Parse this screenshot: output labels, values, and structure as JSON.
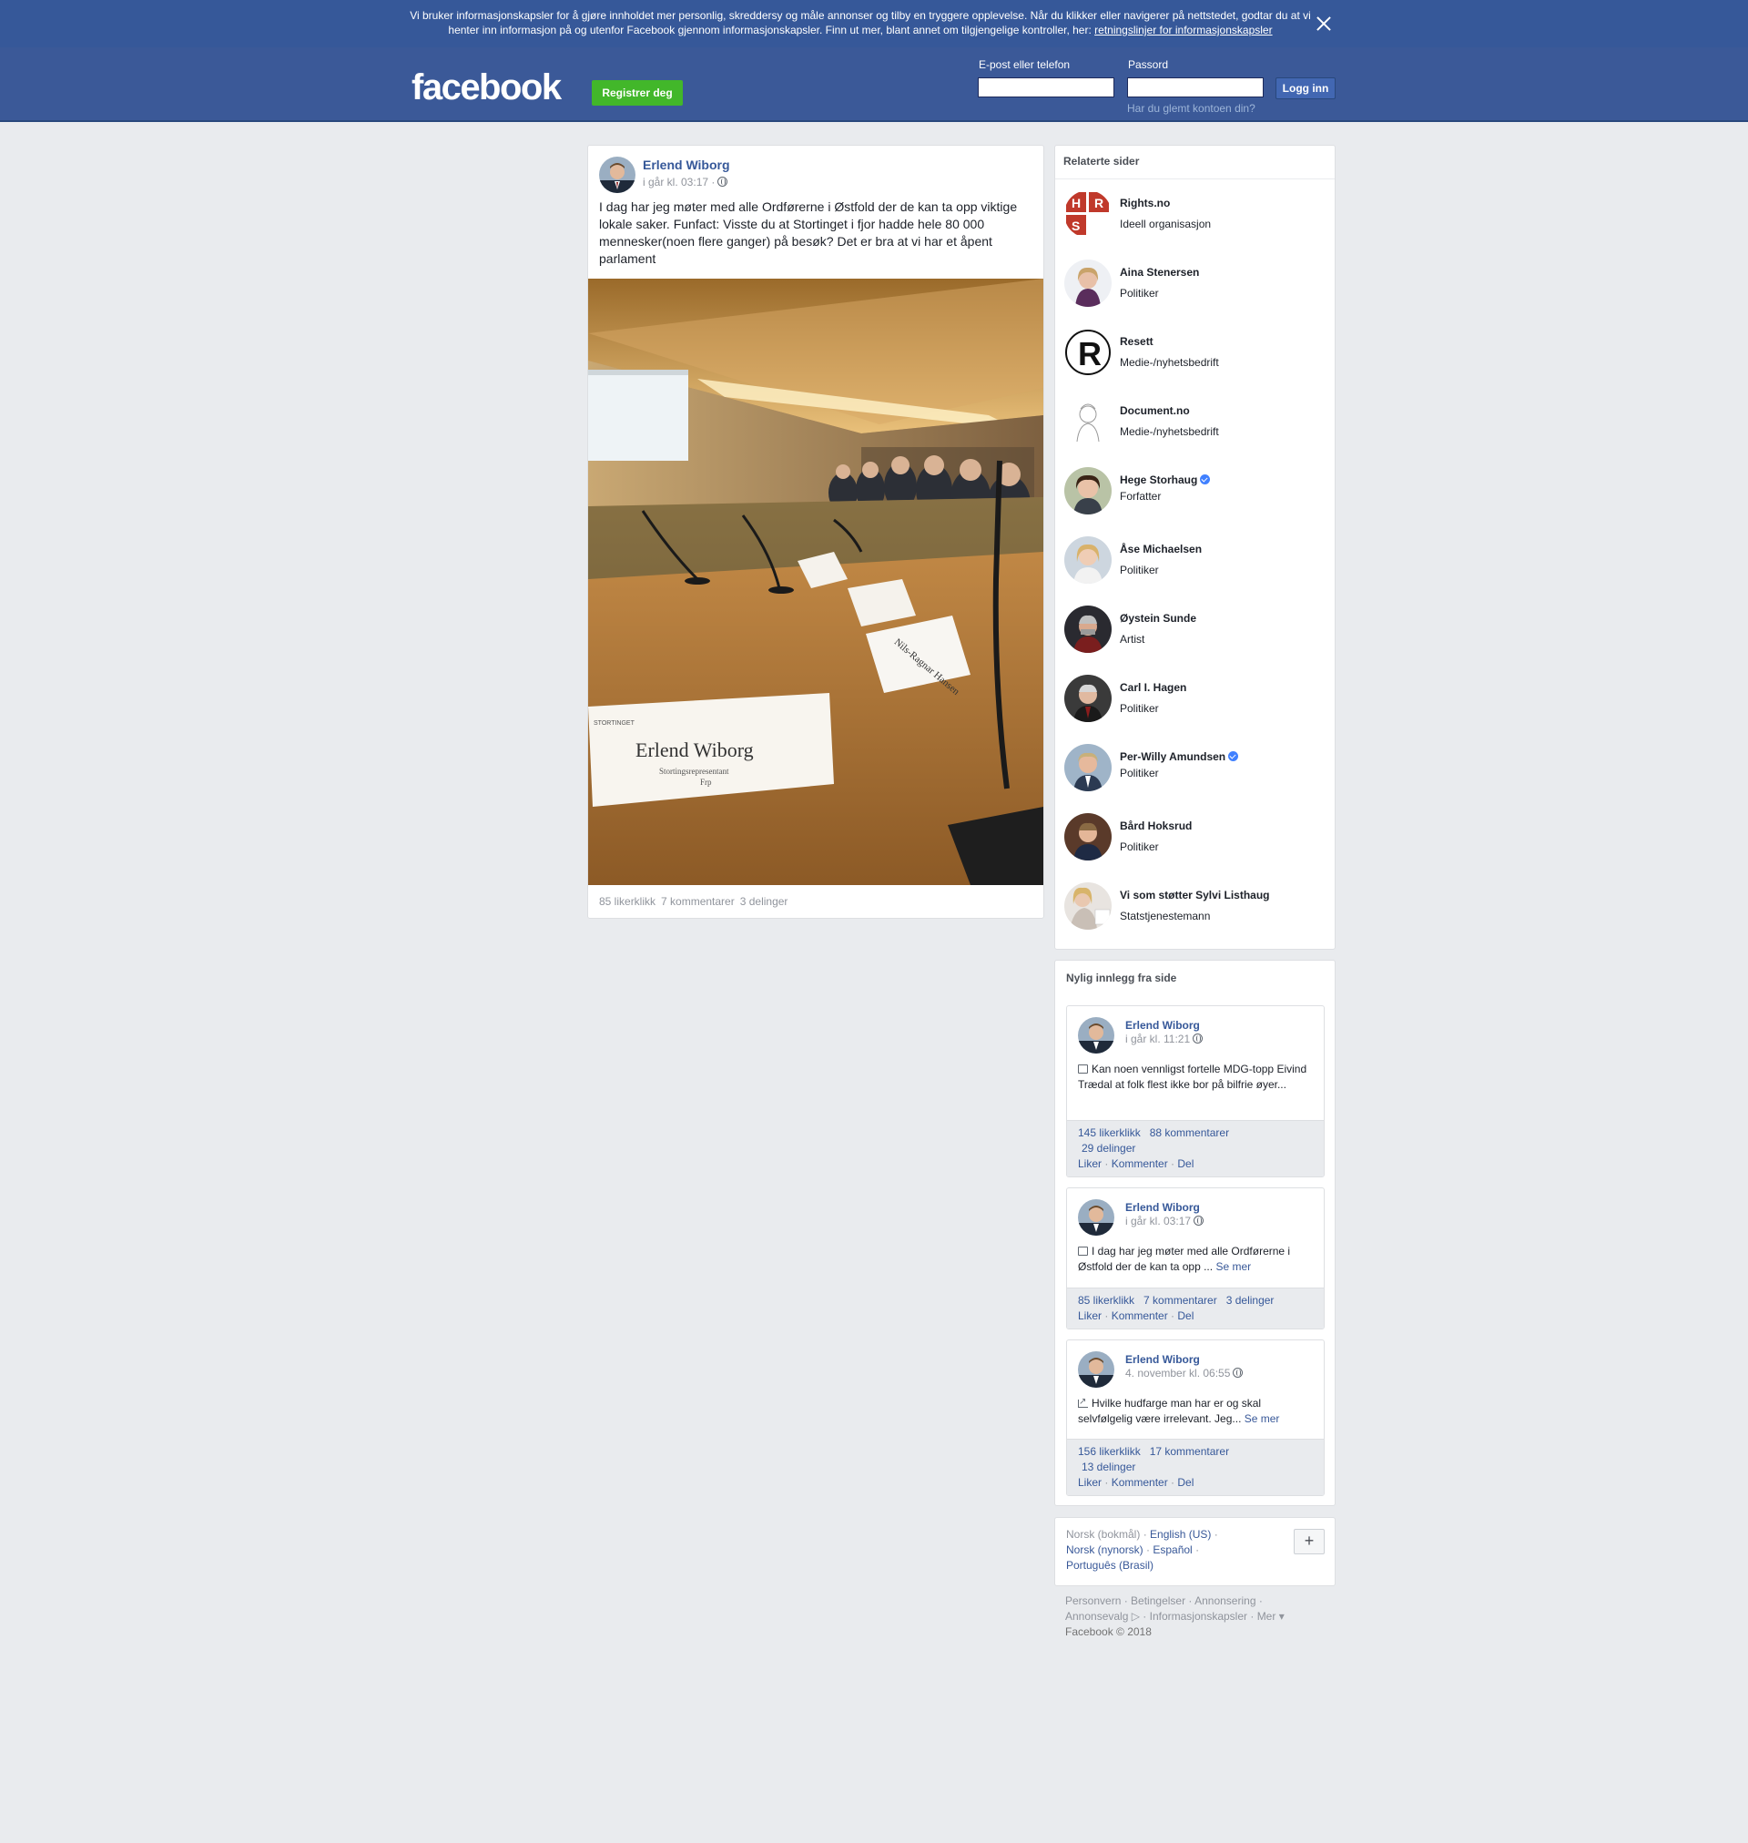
{
  "cookie": {
    "text": "Vi bruker informasjonskapsler for å gjøre innholdet mer personlig, skreddersy og måle annonser og tilby en tryggere opplevelse. Når du klikker eller navigerer på nettstedet, godtar du at vi henter inn informasjon på og utenfor Facebook gjennom informasjonskapsler. Finn ut mer, blant annet om tilgjengelige kontroller, her: ",
    "link": "retningslinjer for informasjonskapsler"
  },
  "header": {
    "logo": "facebook",
    "register": "Registrer deg",
    "email_label": "E-post eller telefon",
    "password_label": "Passord",
    "login": "Logg inn",
    "forgot": "Har du glemt kontoen din?"
  },
  "post": {
    "author": "Erlend Wiborg",
    "time": "i går kl. 03:17 ·",
    "text": "I dag har jeg møter med alle Ordførerne i Østfold der de kan ta opp viktige lokale saker. Funfact: Visste du at Stortinget i fjor hadde hele 80 000 mennesker(noen flere ganger) på besøk? Det er bra at vi har et åpent parlament",
    "photo": {
      "nameplate": "Erlend Wiborg",
      "nameplate_sub1": "Stortingsrepresentant",
      "nameplate_sub2": "Frp",
      "nameplate_top": "STORTINGET",
      "nameplate2": "Nils-Ragnar Hansen"
    },
    "likes": "85 likerklikk",
    "comments": "7 kommentarer",
    "shares": "3 delinger"
  },
  "related": {
    "title": "Relaterte sider",
    "items": [
      {
        "name": "Rights.no",
        "category": "Ideell organisasjon",
        "verified": false
      },
      {
        "name": "Aina Stenersen",
        "category": "Politiker",
        "verified": false
      },
      {
        "name": "Resett",
        "category": "Medie-/nyhetsbedrift",
        "verified": false
      },
      {
        "name": "Document.no",
        "category": "Medie-/nyhetsbedrift",
        "verified": false
      },
      {
        "name": "Hege Storhaug",
        "category": "Forfatter",
        "verified": true
      },
      {
        "name": "Åse Michaelsen",
        "category": "Politiker",
        "verified": false
      },
      {
        "name": "Øystein Sunde",
        "category": "Artist",
        "verified": false
      },
      {
        "name": "Carl I. Hagen",
        "category": "Politiker",
        "verified": false
      },
      {
        "name": "Per-Willy Amundsen",
        "category": "Politiker",
        "verified": true
      },
      {
        "name": "Bård Hoksrud",
        "category": "Politiker",
        "verified": false
      },
      {
        "name": "Vi som støtter Sylvi Listhaug",
        "category": "Statstjenestemann",
        "verified": false
      }
    ],
    "logos": {
      "hrs_letters": [
        "H",
        "R",
        "S"
      ],
      "resett_letter": "R"
    }
  },
  "recent": {
    "title": "Nylig innlegg fra side",
    "posts": [
      {
        "author": "Erlend Wiborg",
        "time": "i går kl. 11:21",
        "text": "Kan noen vennligst fortelle MDG-topp Eivind Trædal at folk flest ikke bor på bilfrie øyer...",
        "see_more": "",
        "likes": "145 likerklikk",
        "comments": "88 kommentarer",
        "shares": "29 delinger"
      },
      {
        "author": "Erlend Wiborg",
        "time": "i går kl. 03:17",
        "text": "I dag har jeg møter med alle Ordførerne i Østfold der de kan ta opp ... ",
        "see_more": "Se mer",
        "likes": "85 likerklikk",
        "comments": "7 kommentarer",
        "shares": "3 delinger"
      },
      {
        "author": "Erlend Wiborg",
        "time": "4. november kl. 06:55",
        "text": "Hvilke hudfarge man har er og skal selvfølgelig være irrelevant. Jeg... ",
        "see_more": "Se mer",
        "likes": "156 likerklikk",
        "comments": "17 kommentarer",
        "shares": "13 delinger"
      }
    ],
    "actions": {
      "like": "Liker",
      "comment": "Kommenter",
      "share": "Del"
    }
  },
  "languages": {
    "current": "Norsk (bokmål)",
    "others": [
      "English (US)",
      "Norsk (nynorsk)",
      "Español",
      "Português (Brasil)"
    ],
    "more": "+"
  },
  "footer": {
    "links": [
      "Personvern",
      "Betingelser",
      "Annonsering",
      "Annonsevalg",
      "Informasjonskapsler",
      "Mer"
    ],
    "copyright": "Facebook © 2018"
  },
  "colors": {
    "brand": "#3b5998",
    "banner": "#365899",
    "register_green": "#42b72a",
    "link": "#365899",
    "page_bg": "#e9ebee"
  }
}
